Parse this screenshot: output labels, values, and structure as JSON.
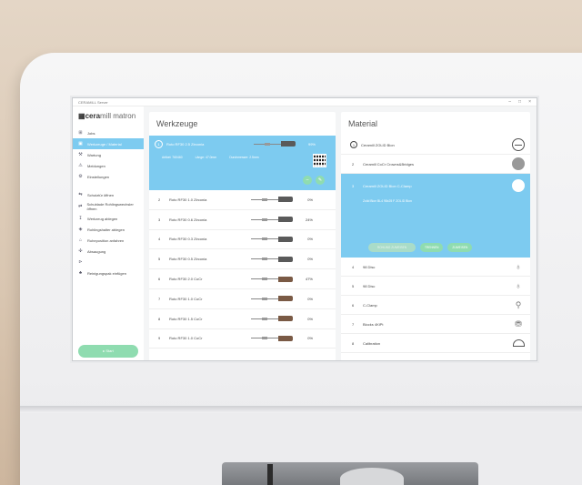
{
  "window": {
    "title": "CERAMILL Server"
  },
  "sidebar": {
    "logo_prefix": "cera",
    "logo_suffix": "mill matron",
    "items": [
      {
        "label": "Jobs",
        "icon": "jobs-icon"
      },
      {
        "label": "Werkzeuge / Material",
        "icon": "tools-icon"
      },
      {
        "label": "Wartung",
        "icon": "wrench-icon"
      },
      {
        "label": "Meldungen",
        "icon": "bell-icon"
      },
      {
        "label": "Einstellungen",
        "icon": "gear-icon"
      },
      {
        "label": "Schutztür öffnen",
        "icon": "door-icon"
      },
      {
        "label": "Schublade Rohlingswechsler öffnen",
        "icon": "drawer-icon"
      },
      {
        "label": "Werkzeug ablegen",
        "icon": "tool-drop-icon"
      },
      {
        "label": "Rohlingshalter ablegen",
        "icon": "holder-icon"
      },
      {
        "label": "Ruheposition anfahren",
        "icon": "home-position-icon"
      },
      {
        "label": "Absaugung",
        "icon": "suction-icon"
      },
      {
        "label": "Reinigungspak einfügen",
        "icon": "cleaning-icon"
      }
    ],
    "start_label": "▸ Start"
  },
  "tools": {
    "title": "Werkzeuge",
    "selected": {
      "num": "1",
      "name": "Roto RF30 2.5 Zirconia",
      "pct": "99%",
      "artikel": "Artikel: 760460",
      "laenge": "Länge: 47.0mm",
      "durchmesser": "Durchmesser: 2.5mm"
    },
    "items": [
      {
        "num": "2",
        "name": "Roto RF30 1.0 Zirconia",
        "pct": "0%",
        "brown": false
      },
      {
        "num": "3",
        "name": "Roto RF30 0.6 Zirconia",
        "pct": "24%",
        "brown": false
      },
      {
        "num": "4",
        "name": "Roto RF30 0.3 Zirconia",
        "pct": "0%",
        "brown": false
      },
      {
        "num": "5",
        "name": "Roto RF30 0.5 Zirconia",
        "pct": "0%",
        "brown": false
      },
      {
        "num": "6",
        "name": "Roto RF30 2.0 CoCr",
        "pct": "47%",
        "brown": true
      },
      {
        "num": "7",
        "name": "Roto RF30 1.0 CoCr",
        "pct": "0%",
        "brown": true
      },
      {
        "num": "8",
        "name": "Roto RF30 1.5 CoCr",
        "pct": "0%",
        "brown": true
      },
      {
        "num": "9",
        "name": "Roto RF30 1.0 CoCr",
        "pct": "0%",
        "brown": true
      }
    ]
  },
  "material": {
    "title": "Material",
    "items_top": [
      {
        "num": "1",
        "name": "Ceramill ZOLID Bion",
        "icon": "disc-icon"
      },
      {
        "num": "2",
        "name": "Ceramill CoCr Crowns&Bridges",
        "icon": "gray-disc-icon"
      }
    ],
    "selected": {
      "num": "3",
      "name": "Ceramill ZOLID Bion C-Clamp",
      "sub": "Zolid Bion BL4 98x25 F    ZOLID Bion",
      "btn_faded": "ROHLING ZUWEISEN",
      "btn_1": "TRENNEN",
      "btn_2": "ZUWEISEN"
    },
    "items_bottom": [
      {
        "num": "4",
        "name": "98 Disc",
        "icon": "fixture-icon"
      },
      {
        "num": "5",
        "name": "98 Disc",
        "icon": "fixture-icon"
      },
      {
        "num": "6",
        "name": "C-Clamp",
        "icon": "clamp-icon"
      },
      {
        "num": "7",
        "name": "Blocks 4KiPt",
        "icon": "blocks-icon"
      },
      {
        "num": "8",
        "name": "Calibration",
        "icon": "dome-icon"
      }
    ]
  }
}
